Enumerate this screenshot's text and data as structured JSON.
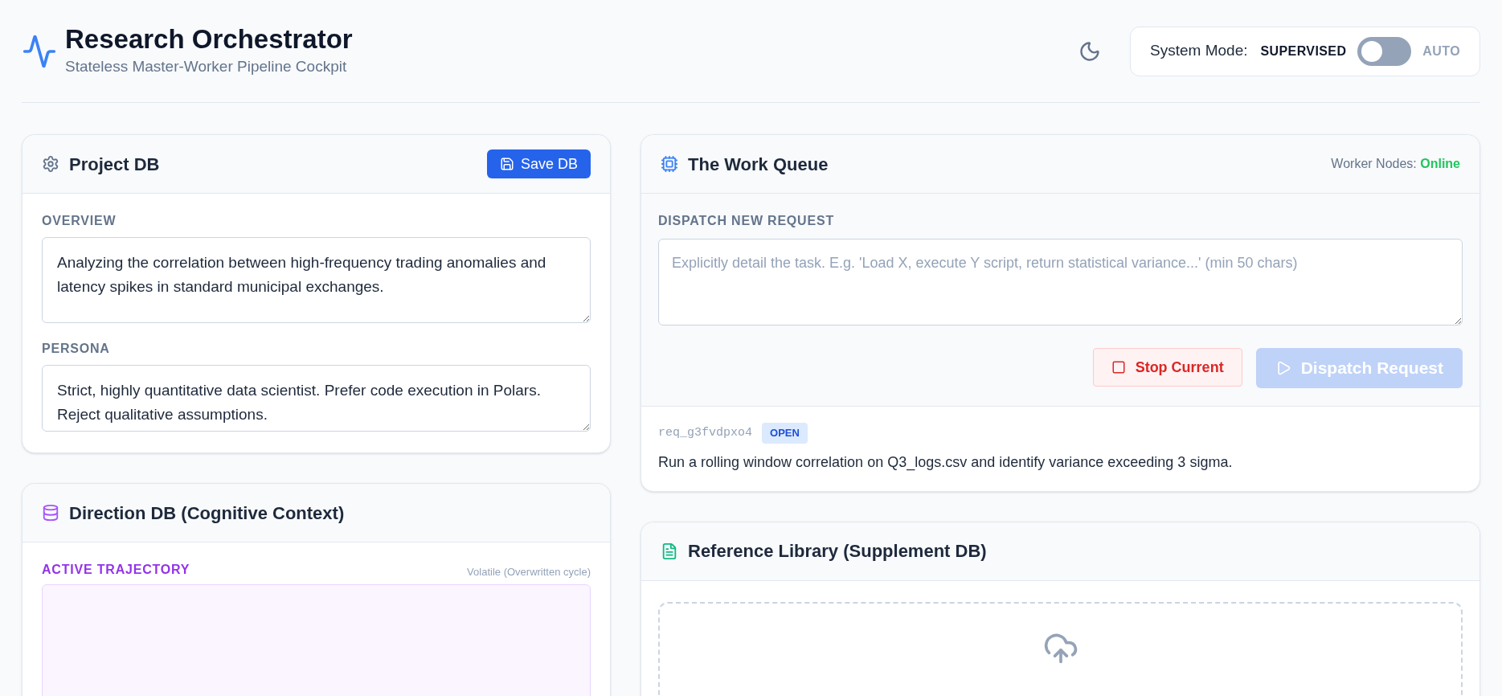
{
  "header": {
    "title": "Research Orchestrator",
    "subtitle": "Stateless Master-Worker Pipeline Cockpit"
  },
  "system_mode": {
    "label": "System Mode:",
    "off_label": "SUPERVISED",
    "on_label": "AUTO",
    "on": false
  },
  "project_db": {
    "title": "Project DB",
    "button": "Save DB",
    "fields": [
      {
        "label": "OVERVIEW",
        "value": "Analyzing the correlation between high-frequency trading anomalies and latency spikes in standard municipal exchanges."
      },
      {
        "label": "PERSONA",
        "value": "Strict, highly quantitative data scientist. Prefer code execution in Polars. Reject qualitative assumptions."
      }
    ]
  },
  "direction_db": {
    "title": "Direction DB (Cognitive Context)",
    "section_label": "ACTIVE TRAJECTORY",
    "note": "Volatile (Overwritten cycle)"
  },
  "work_queue": {
    "title": "The Work Queue",
    "status_label": "Worker Nodes:",
    "status": "Online",
    "request_label": "DISPATCH NEW REQUEST",
    "placeholder": "Explicitly detail the task. E.g. 'Load X, execute Y script, return statistical variance...' (min 50 chars)",
    "buttons": [
      {
        "label": "Stop Current",
        "kind": "stop",
        "disabled": false
      },
      {
        "label": "Dispatch Request",
        "kind": "dispatch",
        "disabled": true
      }
    ],
    "requests": [
      {
        "id": "req_g3fvdpxo4",
        "status": "OPEN",
        "text": "Run a rolling window correlation on Q3_logs.csv and identify variance exceeding 3 sigma."
      }
    ]
  },
  "reference_library": {
    "title": "Reference Library (Supplement DB)"
  }
}
